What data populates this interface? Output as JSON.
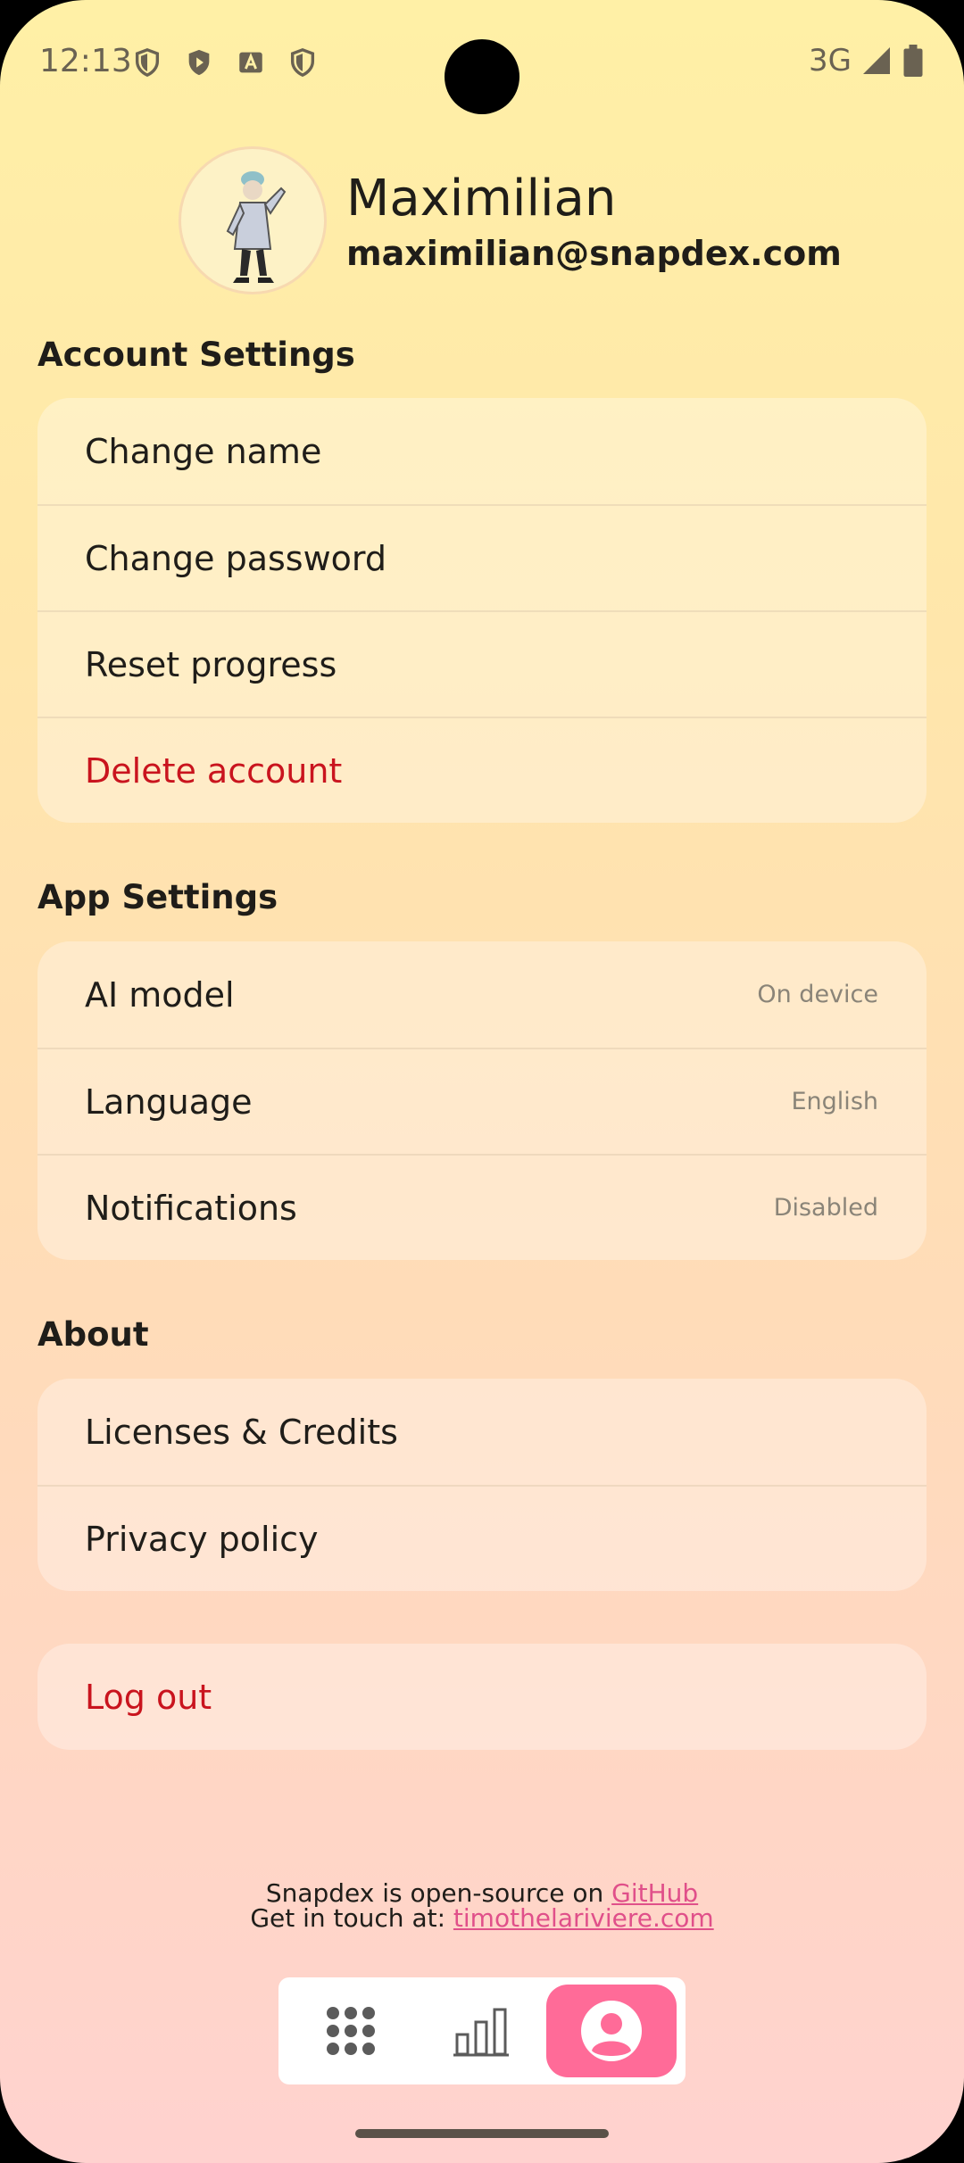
{
  "status_bar": {
    "time": "12:13",
    "network": "3G",
    "icons": [
      "shield-icon",
      "play-shield-icon",
      "text-a-icon",
      "shield-icon",
      "signal-icon",
      "battery-icon"
    ]
  },
  "profile": {
    "name": "Maximilian",
    "email": "maximilian@snapdex.com"
  },
  "account_settings": {
    "title": "Account Settings",
    "items": [
      {
        "label": "Change name"
      },
      {
        "label": "Change password"
      },
      {
        "label": "Reset progress"
      },
      {
        "label": "Delete account"
      }
    ]
  },
  "app_settings": {
    "title": "App Settings",
    "items": [
      {
        "label": "AI model",
        "value": "On device"
      },
      {
        "label": "Language",
        "value": "English"
      },
      {
        "label": "Notifications",
        "value": "Disabled"
      }
    ]
  },
  "about": {
    "title": "About",
    "items": [
      {
        "label": "Licenses & Credits"
      },
      {
        "label": "Privacy policy"
      }
    ]
  },
  "logout": {
    "label": "Log out"
  },
  "footer": {
    "line1_text": "Snapdex is open-source on ",
    "line1_link": "GitHub",
    "line2_text": "Get in touch at: ",
    "line2_link": "timothelariviere.com"
  },
  "bottom_nav": {
    "items": [
      "grid-icon",
      "bar-chart-icon",
      "profile-icon"
    ],
    "active": "profile-icon"
  },
  "colors": {
    "accent": "#ff6b98",
    "danger": "#c9141e",
    "link": "#e0508a"
  }
}
